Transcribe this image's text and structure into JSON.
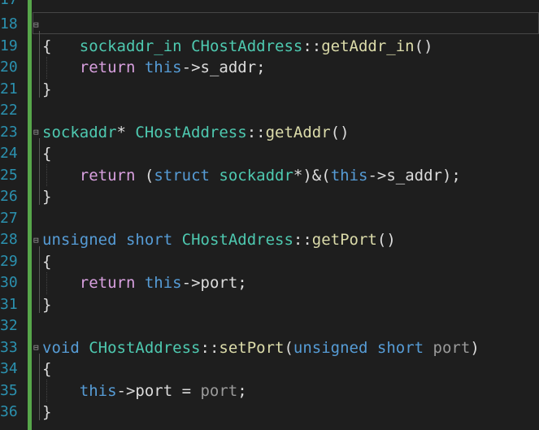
{
  "editor": {
    "line_numbers": [
      "17",
      "18",
      "19",
      "20",
      "21",
      "22",
      "23",
      "24",
      "25",
      "26",
      "27",
      "28",
      "29",
      "30",
      "31",
      "32",
      "33",
      "34",
      "35",
      "36"
    ],
    "lines": [
      "",
      "sockaddr_in CHostAddress::getAddr_in()",
      "{",
      "    return this->s_addr;",
      "}",
      "",
      "sockaddr* CHostAddress::getAddr()",
      "{",
      "    return (struct sockaddr*)&(this->s_addr);",
      "}",
      "",
      "unsigned short CHostAddress::getPort()",
      "{",
      "    return this->port;",
      "}",
      "",
      "void CHostAddress::setPort(unsigned short port)",
      "{",
      "    this->port = port;",
      "}"
    ],
    "collapse_marker": "⊟",
    "colors": {
      "background": "#1e1e1e",
      "line_number": "#2b91af",
      "change_bar": "#57a64a",
      "keyword": "#569cd6",
      "control_keyword": "#d8a0df",
      "type": "#4ec9b0",
      "function": "#dcdcaa",
      "text": "#dcdcdc"
    }
  }
}
